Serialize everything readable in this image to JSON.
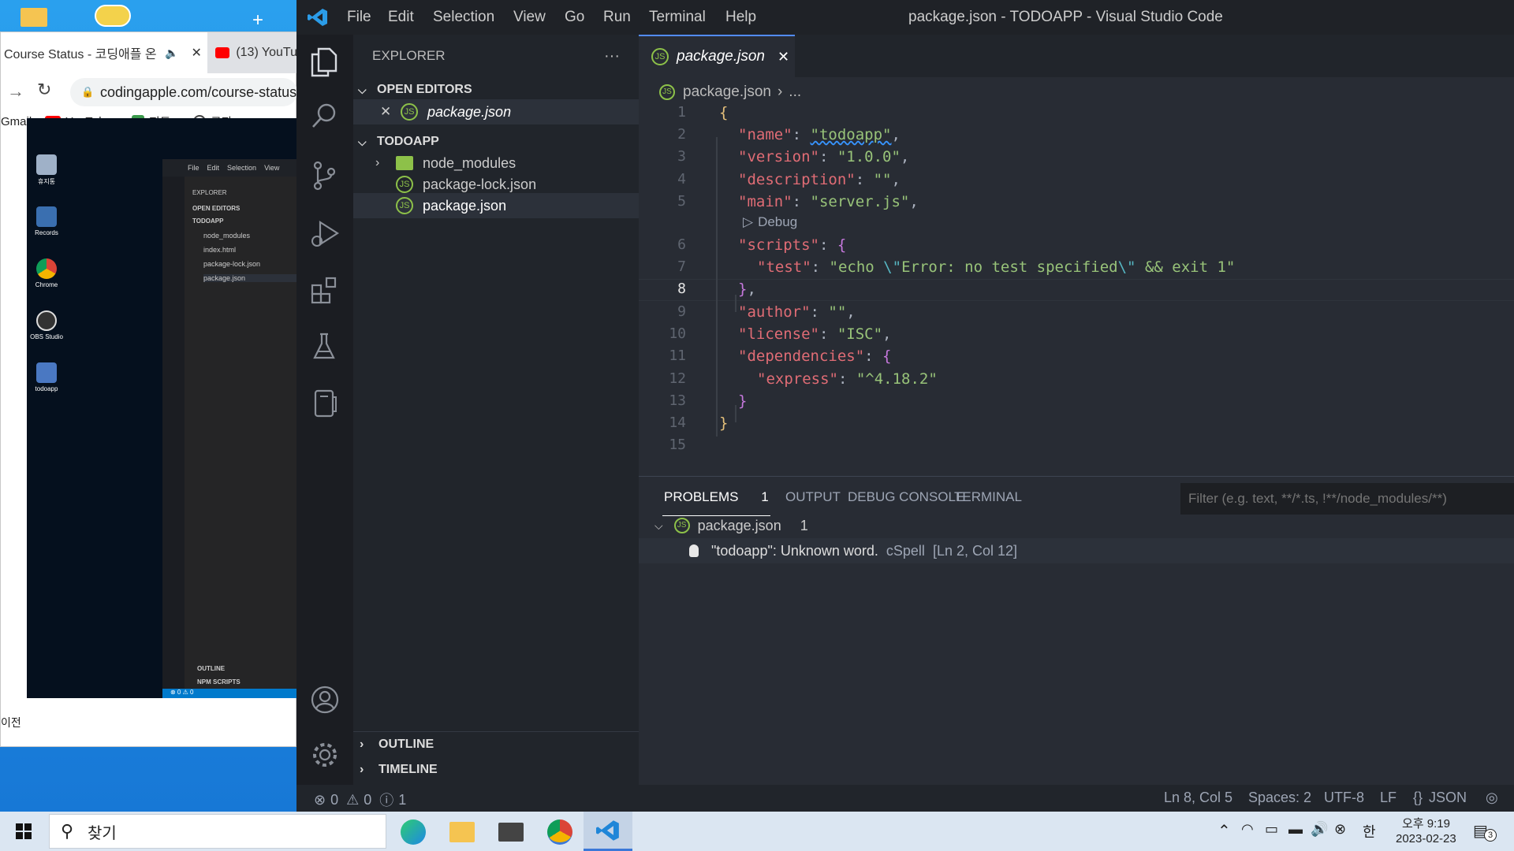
{
  "desktop": {
    "chrome": {
      "tab1": "Course Status - 코딩애플 온",
      "tab2": "(13) YouTu",
      "url": "codingapple.com/course-status",
      "bookmarks": [
        "Gmail",
        "YouTube",
        "지도",
        "쿠팡!"
      ],
      "prev_label": "이전"
    },
    "video": {
      "icons": [
        "휴지통",
        "Records",
        "Chrome",
        "OBS Studio",
        "todoapp"
      ],
      "mini_menu": [
        "File",
        "Edit",
        "Selection",
        "View"
      ],
      "mini_explorer": "EXPLORER",
      "mini_items": [
        "OPEN EDITORS",
        "TODOAPP",
        "node_modules",
        "index.html",
        "package-lock.json",
        "package.json"
      ],
      "mini_outline": "OUTLINE",
      "mini_npm": "NPM SCRIPTS",
      "mini_status": "⊗ 0 ⚠ 0"
    }
  },
  "vscode": {
    "menu": [
      "File",
      "Edit",
      "Selection",
      "View",
      "Go",
      "Run",
      "Terminal",
      "Help"
    ],
    "title": "package.json - TODOAPP - Visual Studio Code",
    "explorer": {
      "title": "EXPLORER",
      "more": "···",
      "open_editors": "OPEN EDITORS",
      "open_file": "package.json",
      "folder": "TODOAPP",
      "items": [
        "node_modules",
        "package-lock.json",
        "package.json"
      ],
      "outline": "OUTLINE",
      "timeline": "TIMELINE"
    },
    "tab": {
      "label": "package.json"
    },
    "breadcrumb": {
      "file": "package.json",
      "rest": "..."
    },
    "code_lines": [
      "1",
      "2",
      "3",
      "4",
      "5",
      "6",
      "7",
      "8",
      "9",
      "10",
      "11",
      "12",
      "13",
      "14",
      "15"
    ],
    "code": {
      "brace_open": "{",
      "brace_close": "}",
      "name_key": "\"name\"",
      "name_val": "\"todoapp\"",
      "version_key": "\"version\"",
      "version_val": "\"1.0.0\"",
      "desc_key": "\"description\"",
      "desc_val": "\"\"",
      "main_key": "\"main\"",
      "main_val": "\"server.js\"",
      "codelens": "Debug",
      "scripts_key": "\"scripts\"",
      "test_key": "\"test\"",
      "test_val_a": "\"echo ",
      "test_esc1": "\\\"",
      "test_val_b": "Error: no test specified",
      "test_esc2": "\\\"",
      "test_val_c": " && exit 1\"",
      "author_key": "\"author\"",
      "author_val": "\"\"",
      "license_key": "\"license\"",
      "license_val": "\"ISC\"",
      "deps_key": "\"dependencies\"",
      "express_key": "\"express\"",
      "express_val": "\"^4.18.2\""
    },
    "panel": {
      "tabs": [
        "PROBLEMS",
        "OUTPUT",
        "DEBUG CONSOLE",
        "TERMINAL"
      ],
      "problems_count": "1",
      "filter_placeholder": "Filter (e.g. text, **/*.ts, !**/node_modules/**)",
      "file": "package.json",
      "file_count": "1",
      "message": "\"todoapp\": Unknown word.",
      "source": "cSpell",
      "location": "[Ln 2, Col 12]"
    },
    "status": {
      "errors": "0",
      "warnings": "0",
      "infos": "1",
      "position": "Ln 8, Col 5",
      "spaces": "Spaces: 2",
      "encoding": "UTF-8",
      "eol": "LF",
      "language": "JSON"
    }
  },
  "taskbar": {
    "search": "찾기",
    "ime": "한",
    "time": "오후 9:19",
    "date": "2023-02-23",
    "notifications": "3"
  }
}
